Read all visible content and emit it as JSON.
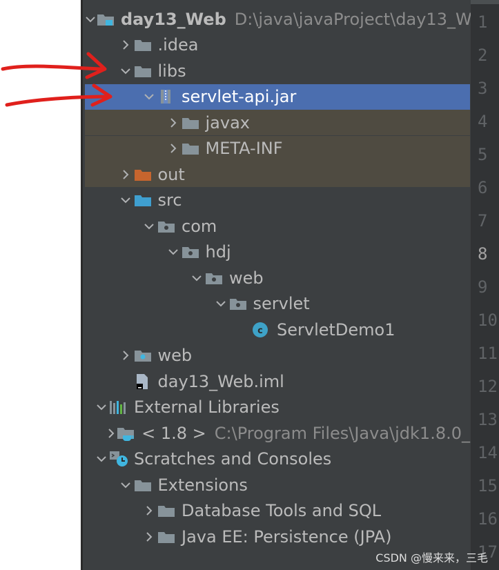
{
  "tree": {
    "rows": [
      {
        "label": "day13_Web",
        "path": "D:\\java\\javaProject\\day13_W",
        "bold": true,
        "icon": "module-folder-icon",
        "depth": 0,
        "expanded": true
      },
      {
        "label": ".idea",
        "icon": "folder-icon",
        "depth": 1,
        "expanded": false
      },
      {
        "label": "libs",
        "icon": "folder-icon",
        "depth": 1,
        "expanded": true
      },
      {
        "label": "servlet-api.jar",
        "icon": "jar-icon",
        "depth": 2,
        "expanded": true,
        "selected": true
      },
      {
        "label": "javax",
        "icon": "folder-icon",
        "depth": 3,
        "expanded": false,
        "lib": true
      },
      {
        "label": "META-INF",
        "icon": "folder-icon",
        "depth": 3,
        "expanded": false,
        "lib": true
      },
      {
        "label": "out",
        "icon": "orange-folder-icon",
        "depth": 1,
        "expanded": false,
        "lib": true
      },
      {
        "label": "src",
        "icon": "blue-folder-icon",
        "depth": 1,
        "expanded": true
      },
      {
        "label": "com",
        "icon": "package-icon",
        "depth": 2,
        "expanded": true
      },
      {
        "label": "hdj",
        "icon": "package-icon",
        "depth": 3,
        "expanded": true
      },
      {
        "label": "web",
        "icon": "package-icon",
        "depth": 4,
        "expanded": true
      },
      {
        "label": "servlet",
        "icon": "package-icon",
        "depth": 5,
        "expanded": true
      },
      {
        "label": "ServletDemo1",
        "icon": "java-class-icon",
        "depth": 6,
        "leaf": true
      },
      {
        "label": "web",
        "icon": "web-folder-icon",
        "depth": 1,
        "expanded": false
      },
      {
        "label": "day13_Web.iml",
        "icon": "iml-file-icon",
        "depth": 1,
        "leaf": true
      },
      {
        "label": "External Libraries",
        "icon": "libraries-icon",
        "depth": 0,
        "expanded": true
      },
      {
        "label": "< 1.8 >",
        "path": "C:\\Program Files\\Java\\jdk1.8.0_",
        "icon": "jdk-icon",
        "depth": 1,
        "expanded": false
      },
      {
        "label": "Scratches and Consoles",
        "icon": "scratches-icon",
        "depth": 0,
        "expanded": true
      },
      {
        "label": "Extensions",
        "icon": "folder-icon",
        "depth": 1,
        "expanded": true
      },
      {
        "label": "Database Tools and SQL",
        "icon": "folder-icon",
        "depth": 2,
        "expanded": false
      },
      {
        "label": "Java EE: Persistence (JPA)",
        "icon": "folder-icon",
        "depth": 2,
        "expanded": false
      }
    ]
  },
  "gutter": {
    "line_numbers": [
      "1",
      "2",
      "3",
      "4",
      "5",
      "6",
      "7",
      "8",
      "9",
      "10",
      "11",
      "12",
      "13",
      "14",
      "15",
      "16",
      "17"
    ],
    "active_line": "8"
  },
  "watermark": "CSDN @慢来来，三毛",
  "colors": {
    "panel_bg": "#3c3f41",
    "selection": "#4b6eaf",
    "library_highlight": "#4f4b41",
    "annotation_arrow": "#e0201c"
  }
}
